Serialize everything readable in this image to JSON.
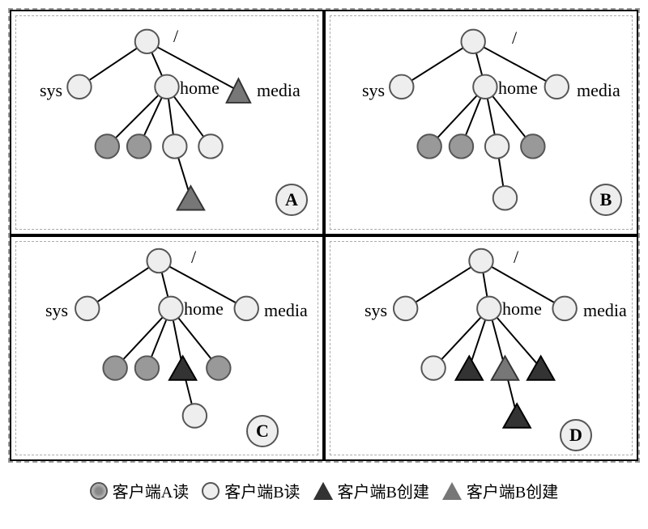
{
  "panels": {
    "A": "A",
    "B": "B",
    "C": "C",
    "D": "D"
  },
  "labels": {
    "root": "/",
    "sys": "sys",
    "home": "home",
    "media": "media"
  },
  "legend": {
    "a_read": "客户端A读",
    "b_read": "客户端B读",
    "b_create1": "客户端B创建",
    "b_create2": "客户端B创建"
  },
  "chart_data": {
    "type": "diagram",
    "description": "Four panels A-D each showing a filesystem tree rooted at '/', with children 'sys', 'home', 'media'. Leaf nodes are decorated to indicate which client (A or B) read or created them.",
    "node_labels": [
      "/",
      "sys",
      "home",
      "media"
    ],
    "panels": [
      {
        "id": "A",
        "tree": {
          "root": {
            "type": "light"
          },
          "sys": {
            "type": "light"
          },
          "home": {
            "type": "light",
            "children": [
              "hatch",
              "hatch",
              "light",
              "light"
            ],
            "grandchild_from_index": 2,
            "grandchild": "tri-cross"
          },
          "media": {
            "type": "tri-cross"
          }
        }
      },
      {
        "id": "B",
        "tree": {
          "root": {
            "type": "light"
          },
          "sys": {
            "type": "light"
          },
          "home": {
            "type": "light",
            "children": [
              "hatch",
              "hatch",
              "light",
              "hatch"
            ],
            "grandchild_from_index": 2,
            "grandchild": "light"
          },
          "media": {
            "type": "light"
          }
        }
      },
      {
        "id": "C",
        "tree": {
          "root": {
            "type": "light"
          },
          "sys": {
            "type": "light"
          },
          "home": {
            "type": "light",
            "children": [
              "hatch",
              "hatch",
              "tri-dark",
              "hatch"
            ],
            "grandchild_from_index": 2,
            "grandchild": "light"
          },
          "media": {
            "type": "light"
          }
        }
      },
      {
        "id": "D",
        "tree": {
          "root": {
            "type": "light"
          },
          "sys": {
            "type": "light"
          },
          "home": {
            "type": "light",
            "children": [
              "light",
              "tri-dark",
              "tri-cross",
              "tri-dark"
            ],
            "grandchild_from_index": 2,
            "grandchild": "tri-dark"
          },
          "media": {
            "type": "light"
          }
        }
      }
    ]
  }
}
